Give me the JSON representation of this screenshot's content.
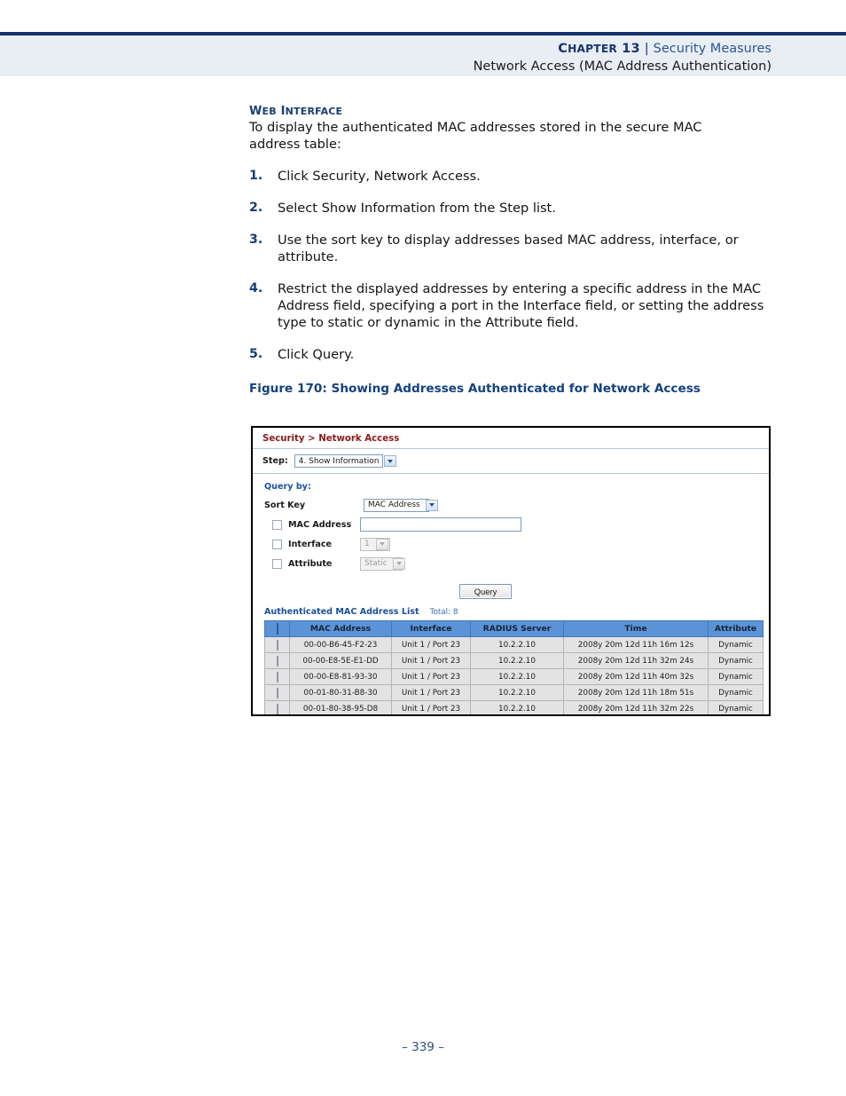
{
  "header": {
    "chapter": "CHAPTER 13",
    "separator": "|",
    "subject": "Security Measures",
    "subtitle": "Network Access (MAC Address Authentication)"
  },
  "content": {
    "section_label": "WEB INTERFACE",
    "intro": "To display the authenticated MAC addresses stored in the secure MAC address table:",
    "steps": [
      {
        "num": "1.",
        "text": "Click Security, Network Access."
      },
      {
        "num": "2.",
        "text": "Select Show Information from the Step list."
      },
      {
        "num": "3.",
        "text": "Use the sort key to display addresses based MAC address, interface, or attribute."
      },
      {
        "num": "4.",
        "text": "Restrict the displayed addresses by entering a specific address in the MAC Address field, specifying a port in the Interface field, or setting the address type to static or dynamic in the Attribute field."
      },
      {
        "num": "5.",
        "text": "Click Query."
      }
    ],
    "figure_caption": "Figure 170:  Showing Addresses Authenticated for Network Access"
  },
  "figure": {
    "breadcrumb": "Security > Network Access",
    "step": {
      "label": "Step:",
      "value": "4. Show Information",
      "icon": "chevron-down-icon"
    },
    "query": {
      "heading": "Query by:",
      "sort_key_label": "Sort Key",
      "sort_key_value": "MAC Address",
      "mac_address_label": "MAC Address",
      "mac_address_value": "",
      "interface_label": "Interface",
      "interface_value": "1",
      "attribute_label": "Attribute",
      "attribute_value": "Static",
      "query_button": "Query"
    },
    "list": {
      "title": "Authenticated MAC Address List",
      "total": "Total: 8",
      "columns": [
        "",
        "MAC Address",
        "Interface",
        "RADIUS Server",
        "Time",
        "Attribute"
      ],
      "rows": [
        {
          "mac": "00-00-B6-45-F2-23",
          "interface": "Unit 1 / Port 23",
          "radius": "10.2.2.10",
          "time": "2008y 20m 12d 11h 16m 12s",
          "attribute": "Dynamic"
        },
        {
          "mac": "00-00-E8-5E-E1-DD",
          "interface": "Unit 1 / Port 23",
          "radius": "10.2.2.10",
          "time": "2008y 20m 12d 11h 32m 24s",
          "attribute": "Dynamic"
        },
        {
          "mac": "00-00-E8-81-93-30",
          "interface": "Unit 1 / Port 23",
          "radius": "10.2.2.10",
          "time": "2008y 20m 12d 11h 40m 32s",
          "attribute": "Dynamic"
        },
        {
          "mac": "00-01-80-31-B8-30",
          "interface": "Unit 1 / Port 23",
          "radius": "10.2.2.10",
          "time": "2008y 20m 12d 11h 18m 51s",
          "attribute": "Dynamic"
        },
        {
          "mac": "00-01-80-38-95-D8",
          "interface": "Unit 1 / Port 23",
          "radius": "10.2.2.10",
          "time": "2008y 20m 12d 11h 32m 22s",
          "attribute": "Dynamic"
        }
      ]
    }
  },
  "footer": {
    "page_number": "–  339  –"
  },
  "colors": {
    "header_band": "#e9edf4",
    "rule": "#13306b",
    "heading_blue": "#1a3c74",
    "breadcrumb_red": "#8b1a1a",
    "table_header_blue": "#5b93d6"
  }
}
